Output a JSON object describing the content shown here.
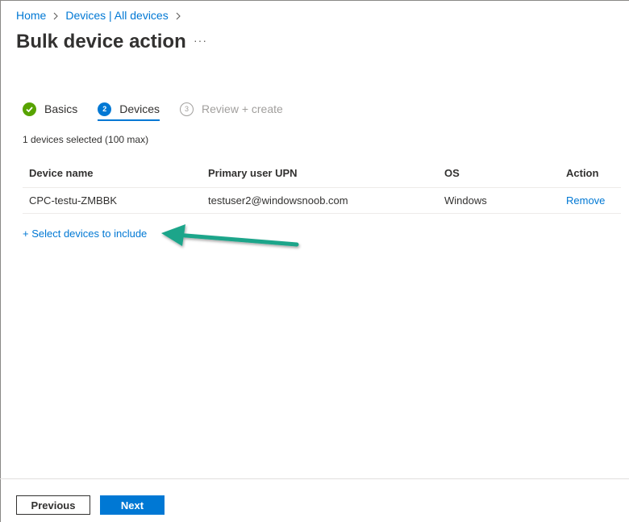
{
  "breadcrumb": {
    "items": [
      {
        "label": "Home"
      },
      {
        "label": "Devices | All devices"
      }
    ]
  },
  "page": {
    "title": "Bulk device action",
    "more_label": "···"
  },
  "wizard": {
    "steps": [
      {
        "number": "1",
        "label": "Basics",
        "state": "completed"
      },
      {
        "number": "2",
        "label": "Devices",
        "state": "active"
      },
      {
        "number": "3",
        "label": "Review + create",
        "state": "disabled"
      }
    ]
  },
  "devices": {
    "selected_text": "1 devices selected (100 max)",
    "columns": [
      "Device name",
      "Primary user UPN",
      "OS",
      "Action"
    ],
    "rows": [
      {
        "name": "CPC-testu-ZMBBK",
        "upn": "testuser2@windowsnoob.com",
        "os": "Windows",
        "action": "Remove"
      }
    ],
    "add_link": "+ Select devices to include"
  },
  "annotation": {
    "arrow_color": "#1aa58a"
  },
  "footer": {
    "previous_label": "Previous",
    "next_label": "Next"
  },
  "colors": {
    "accent": "#0078d4",
    "success": "#57a300",
    "text": "#323130",
    "disabled": "#a19f9d"
  }
}
